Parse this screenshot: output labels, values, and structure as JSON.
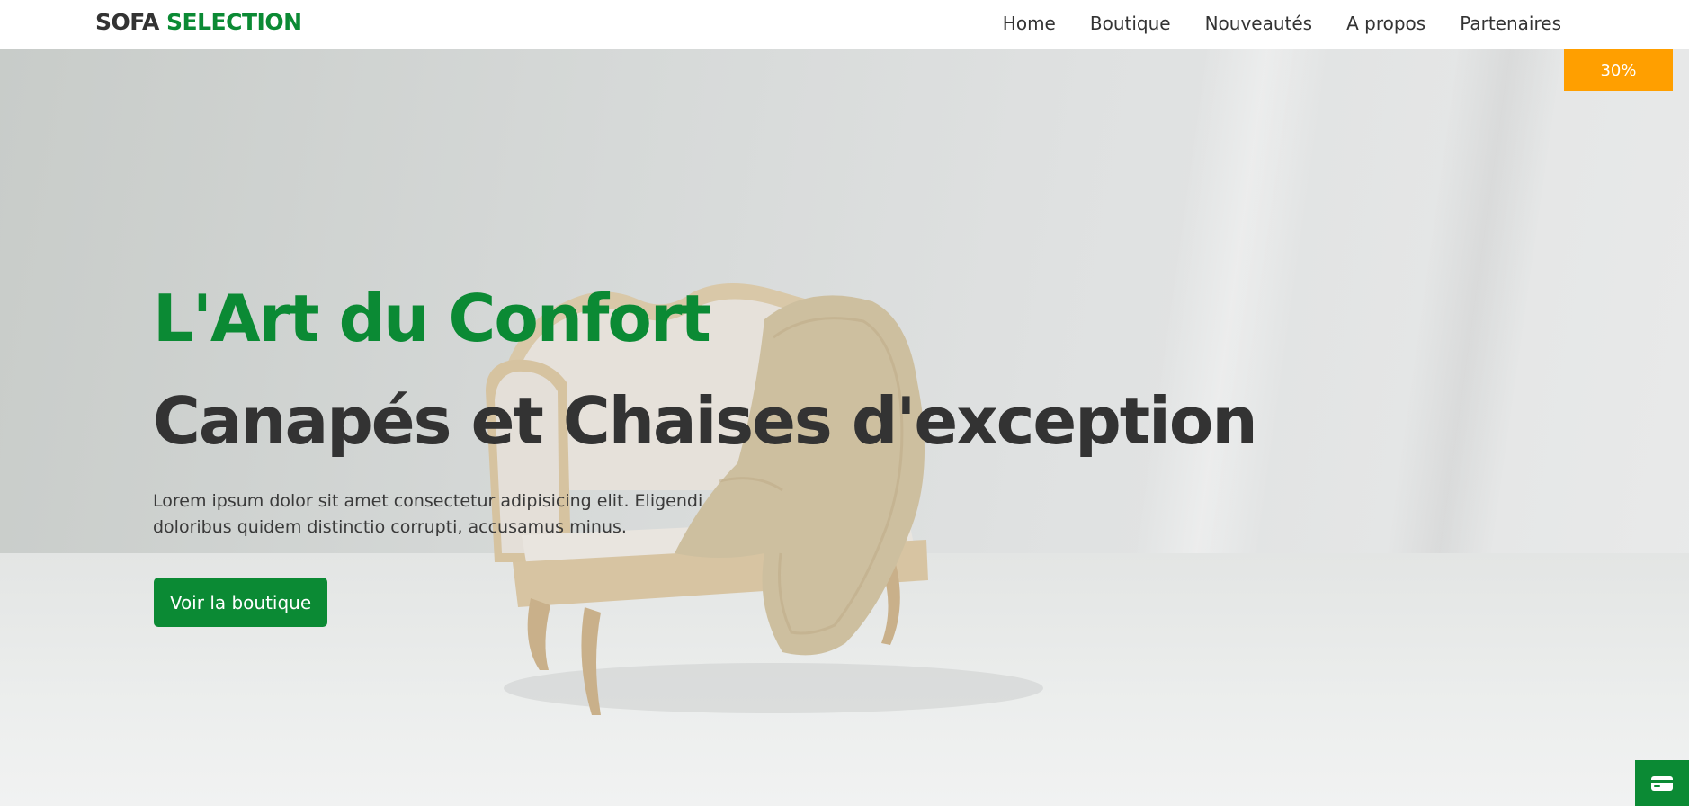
{
  "header": {
    "brand_part1": "SOFA",
    "brand_part2": "SELECTION",
    "nav": [
      {
        "label": "Home"
      },
      {
        "label": "Boutique"
      },
      {
        "label": "Nouveautés"
      },
      {
        "label": "A propos"
      },
      {
        "label": "Partenaires"
      }
    ]
  },
  "badge": {
    "text": "30%"
  },
  "hero": {
    "title_green": "L'Art du Confort",
    "title_dark": "Canapés et Chaises d'exception",
    "lead": "Lorem ipsum dolor sit amet consectetur adipisicing elit. Eligendi doloribus quidem distinctio corrupti, accusamus minus.",
    "cta_label": "Voir la boutique"
  },
  "floating": {
    "icon": "credit-card-icon"
  },
  "colors": {
    "brand_green": "#0b8a34",
    "badge_orange": "#ff9f00",
    "text_dark": "#333333"
  }
}
